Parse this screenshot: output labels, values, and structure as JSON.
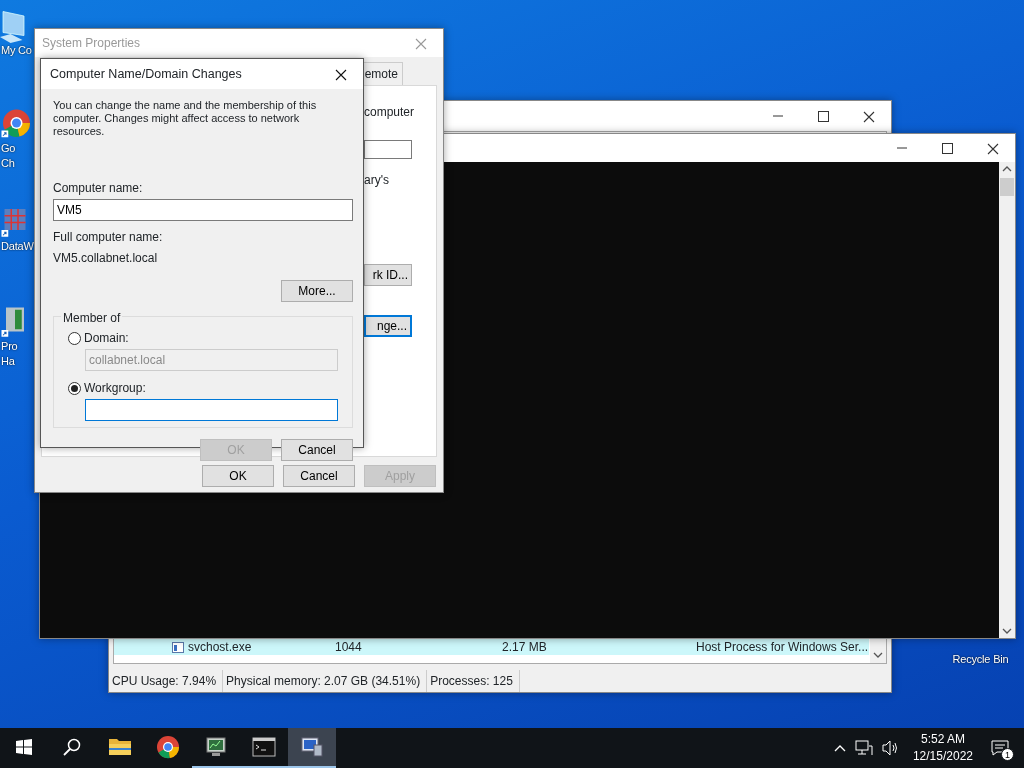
{
  "desktop_icons": [
    {
      "kind": "computer",
      "lines": [
        "My Co"
      ]
    },
    {
      "kind": "chrome",
      "lines": [
        "Go",
        "Ch"
      ]
    },
    {
      "kind": "grid",
      "lines": [
        "DataW"
      ]
    },
    {
      "kind": "server",
      "lines": [
        "Pro",
        "Ha"
      ]
    },
    {
      "kind": "bin",
      "lines": [
        "Recycle Bin"
      ]
    }
  ],
  "task_manager": {
    "rows": [
      {
        "name": "svchost.exe",
        "pid": "1044",
        "memory": "2.17 MB",
        "description": "Host Process for Windows Ser...",
        "selected": true
      }
    ],
    "status_bar": [
      "CPU Usage: 7.94%",
      "Physical memory: 2.07 GB (34.51%)",
      "Processes: 125"
    ]
  },
  "system_properties": {
    "title": "System Properties",
    "active": false,
    "tab": "emote",
    "texts": [
      "computer",
      "ary's"
    ],
    "side_buttons": [
      {
        "label": "rk ID...",
        "focused": false
      },
      {
        "label": "nge...",
        "focused": true
      }
    ],
    "buttons": [
      {
        "label": "OK",
        "disabled": false
      },
      {
        "label": "Cancel",
        "disabled": false
      },
      {
        "label": "Apply",
        "disabled": true
      }
    ]
  },
  "dialog": {
    "title": "Computer Name/Domain Changes",
    "description": "You can change the name and the membership of this computer. Changes might affect access to network resources.",
    "computer_name_label": "Computer name:",
    "computer_name": "VM5",
    "full_name_label": "Full computer name:",
    "full_name": "VM5.collabnet.local",
    "more_button": "More...",
    "group_label": "Member of",
    "options": [
      {
        "label": "Domain:",
        "selected": false,
        "value": "collabnet.local"
      },
      {
        "label": "Workgroup:",
        "selected": true
      }
    ],
    "buttons": [
      {
        "label": "OK",
        "disabled": true
      },
      {
        "label": "Cancel",
        "disabled": false
      }
    ]
  },
  "taskbar": {
    "apps": [
      {
        "kind": "folder",
        "running": false,
        "active": false
      },
      {
        "kind": "chrome",
        "running": false,
        "active": false
      },
      {
        "kind": "monitor",
        "running": true,
        "active": false
      },
      {
        "kind": "console",
        "running": true,
        "active": false
      },
      {
        "kind": "network",
        "running": true,
        "active": true
      }
    ],
    "time": "5:52 AM",
    "date": "12/15/2022",
    "notifications": "1"
  }
}
